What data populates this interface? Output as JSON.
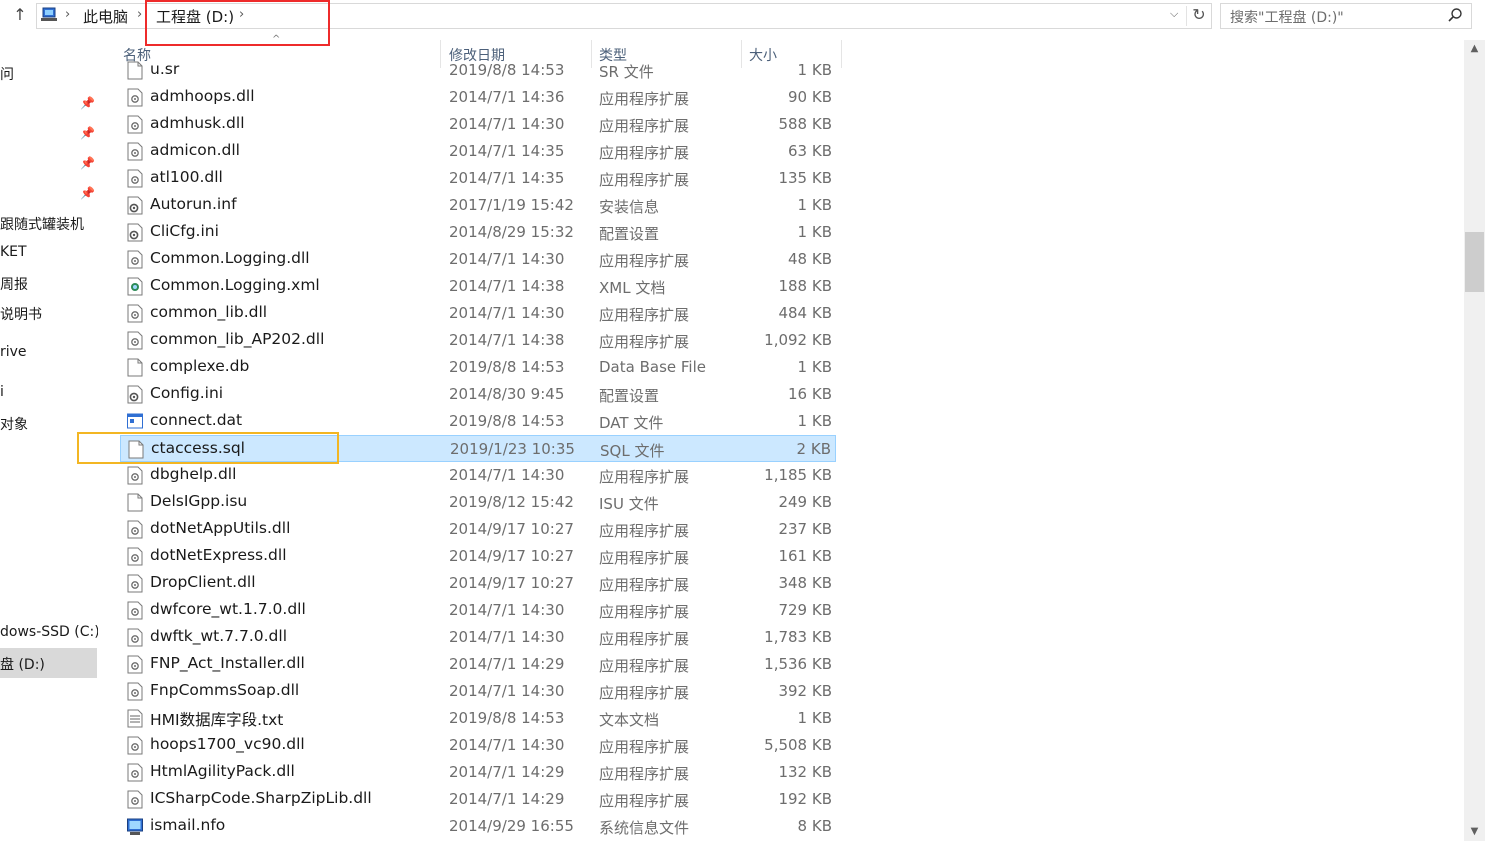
{
  "address": {
    "crumbs": [
      "此电脑",
      "工程盘 (D:)"
    ],
    "search_placeholder": "搜索\"工程盘 (D:)\""
  },
  "nav": {
    "items": [
      "问",
      "跟随式罐装机",
      "KET",
      "周报",
      "说明书",
      "rive",
      "i",
      "对象",
      "dows-SSD (C:)",
      "盘 (D:)"
    ]
  },
  "columns": {
    "name": "名称",
    "date": "修改日期",
    "type": "类型",
    "size": "大小"
  },
  "files": [
    {
      "name": "u.sr",
      "date": "2019/8/8 14:53",
      "type": "SR 文件",
      "size": "1 KB",
      "icon": "generic-file"
    },
    {
      "name": "admhoops.dll",
      "date": "2014/7/1 14:36",
      "type": "应用程序扩展",
      "size": "90 KB",
      "icon": "dll-file"
    },
    {
      "name": "admhusk.dll",
      "date": "2014/7/1 14:30",
      "type": "应用程序扩展",
      "size": "588 KB",
      "icon": "dll-file"
    },
    {
      "name": "admicon.dll",
      "date": "2014/7/1 14:35",
      "type": "应用程序扩展",
      "size": "63 KB",
      "icon": "dll-file"
    },
    {
      "name": "atl100.dll",
      "date": "2014/7/1 14:35",
      "type": "应用程序扩展",
      "size": "135 KB",
      "icon": "dll-file"
    },
    {
      "name": "Autorun.inf",
      "date": "2017/1/19 15:42",
      "type": "安装信息",
      "size": "1 KB",
      "icon": "settings-file"
    },
    {
      "name": "CliCfg.ini",
      "date": "2014/8/29 15:32",
      "type": "配置设置",
      "size": "1 KB",
      "icon": "settings-file"
    },
    {
      "name": "Common.Logging.dll",
      "date": "2014/7/1 14:30",
      "type": "应用程序扩展",
      "size": "48 KB",
      "icon": "dll-file"
    },
    {
      "name": "Common.Logging.xml",
      "date": "2014/7/1 14:38",
      "type": "XML 文档",
      "size": "188 KB",
      "icon": "xml-file"
    },
    {
      "name": "common_lib.dll",
      "date": "2014/7/1 14:30",
      "type": "应用程序扩展",
      "size": "484 KB",
      "icon": "dll-file"
    },
    {
      "name": "common_lib_AP202.dll",
      "date": "2014/7/1 14:38",
      "type": "应用程序扩展",
      "size": "1,092 KB",
      "icon": "dll-file"
    },
    {
      "name": "complexe.db",
      "date": "2019/8/8 14:53",
      "type": "Data Base File",
      "size": "1 KB",
      "icon": "generic-file"
    },
    {
      "name": "Config.ini",
      "date": "2014/8/30 9:45",
      "type": "配置设置",
      "size": "16 KB",
      "icon": "settings-file"
    },
    {
      "name": "connect.dat",
      "date": "2019/8/8 14:53",
      "type": "DAT 文件",
      "size": "1 KB",
      "icon": "dat-file"
    },
    {
      "name": "ctaccess.sql",
      "date": "2019/1/23 10:35",
      "type": "SQL 文件",
      "size": "2 KB",
      "icon": "generic-file",
      "selected": true
    },
    {
      "name": "dbghelp.dll",
      "date": "2014/7/1 14:30",
      "type": "应用程序扩展",
      "size": "1,185 KB",
      "icon": "dll-file"
    },
    {
      "name": "DelsIGpp.isu",
      "date": "2019/8/12 15:42",
      "type": "ISU 文件",
      "size": "249 KB",
      "icon": "generic-file"
    },
    {
      "name": "dotNetAppUtils.dll",
      "date": "2014/9/17 10:27",
      "type": "应用程序扩展",
      "size": "237 KB",
      "icon": "dll-file"
    },
    {
      "name": "dotNetExpress.dll",
      "date": "2014/9/17 10:27",
      "type": "应用程序扩展",
      "size": "161 KB",
      "icon": "dll-file"
    },
    {
      "name": "DropClient.dll",
      "date": "2014/9/17 10:27",
      "type": "应用程序扩展",
      "size": "348 KB",
      "icon": "dll-file"
    },
    {
      "name": "dwfcore_wt.1.7.0.dll",
      "date": "2014/7/1 14:30",
      "type": "应用程序扩展",
      "size": "729 KB",
      "icon": "dll-file"
    },
    {
      "name": "dwftk_wt.7.7.0.dll",
      "date": "2014/7/1 14:30",
      "type": "应用程序扩展",
      "size": "1,783 KB",
      "icon": "dll-file"
    },
    {
      "name": "FNP_Act_Installer.dll",
      "date": "2014/7/1 14:29",
      "type": "应用程序扩展",
      "size": "1,536 KB",
      "icon": "dll-file"
    },
    {
      "name": "FnpCommsSoap.dll",
      "date": "2014/7/1 14:30",
      "type": "应用程序扩展",
      "size": "392 KB",
      "icon": "dll-file"
    },
    {
      "name": "HMI数据库字段.txt",
      "date": "2019/8/8 14:53",
      "type": "文本文档",
      "size": "1 KB",
      "icon": "text-file"
    },
    {
      "name": "hoops1700_vc90.dll",
      "date": "2014/7/1 14:30",
      "type": "应用程序扩展",
      "size": "5,508 KB",
      "icon": "dll-file"
    },
    {
      "name": "HtmlAgilityPack.dll",
      "date": "2014/7/1 14:29",
      "type": "应用程序扩展",
      "size": "132 KB",
      "icon": "dll-file"
    },
    {
      "name": "ICSharpCode.SharpZipLib.dll",
      "date": "2014/7/1 14:29",
      "type": "应用程序扩展",
      "size": "192 KB",
      "icon": "dll-file"
    },
    {
      "name": "ismail.nfo",
      "date": "2014/9/29 16:55",
      "type": "系统信息文件",
      "size": "8 KB",
      "icon": "nfo-file"
    }
  ]
}
